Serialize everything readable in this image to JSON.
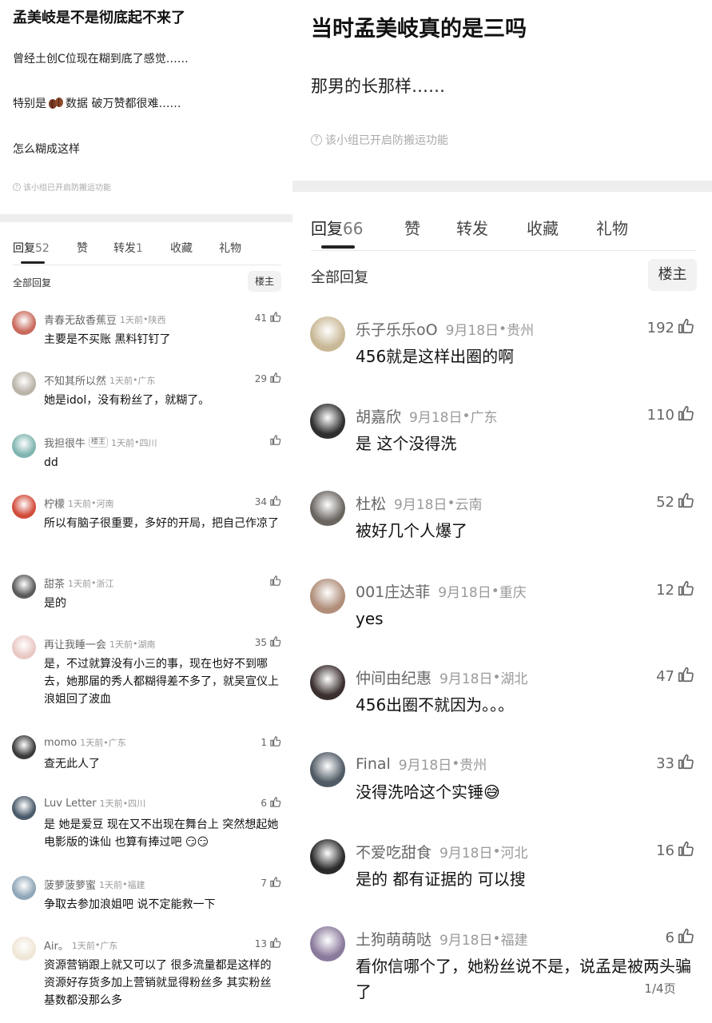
{
  "left": {
    "post_title": "孟美岐是不是彻底起不来了",
    "body_lines": [
      "曾经土创C位现在糊到底了感觉……",
      "特别是",
      "数据 破万赞都很难……",
      "怎么糊成这样"
    ],
    "anti_repost": "该小组已开启防搬运功能",
    "tabs": [
      {
        "label": "回复",
        "count": "52"
      },
      {
        "label": "赞",
        "count": ""
      },
      {
        "label": "转发",
        "count": "1"
      },
      {
        "label": "收藏",
        "count": ""
      },
      {
        "label": "礼物",
        "count": ""
      }
    ],
    "all_replies": "全部回复",
    "host_button": "楼主",
    "comments": [
      {
        "name": "青春无敌香蕉豆",
        "time": "1天前",
        "loc": "陕西",
        "likes": "41",
        "text": "主要是不买账 黑料钉钉了",
        "avatar": "#c96a5c"
      },
      {
        "name": "不知其所以然",
        "time": "1天前",
        "loc": "广东",
        "likes": "29",
        "text": "她是idol，没有粉丝了，就糊了。",
        "avatar": "#b9b3a8"
      },
      {
        "name": "我担很牛",
        "badge": "楼主",
        "time": "1天前",
        "loc": "四川",
        "likes": "",
        "text": "dd",
        "avatar": "#7fb5b0"
      },
      {
        "name": "柠檬",
        "time": "1天前",
        "loc": "河南",
        "likes": "34",
        "text": "所以有脑子很重要，多好的开局，把自己作凉了",
        "avatar": "#d24b3b"
      },
      {
        "name": "甜茶",
        "time": "1天前",
        "loc": "浙江",
        "likes": "",
        "text": "是的",
        "avatar": "#5a5a5a"
      },
      {
        "name": "再让我睡一会",
        "time": "1天前",
        "loc": "湖南",
        "likes": "35",
        "text": "是，不过就算没有小三的事，现在也好不到哪去，她那届的秀人都糊得差不多了，就吴宣仪上浪姐回了波血",
        "avatar": "#e9c8c4"
      },
      {
        "name": "momo",
        "time": "1天前",
        "loc": "广东",
        "likes": "1",
        "text": "查无此人了",
        "avatar": "#3a3a3a"
      },
      {
        "name": "Luv Letter",
        "time": "1天前",
        "loc": "四川",
        "likes": "6",
        "text": "是 她是爱豆 现在又不出现在舞台上 突然想起她电影版的诛仙 也算有捧过吧 😏😏",
        "avatar": "#4a5a6a"
      },
      {
        "name": "菠萝菠萝蜜",
        "time": "1天前",
        "loc": "福建",
        "likes": "7",
        "text": "争取去参加浪姐吧 说不定能救一下",
        "avatar": "#8fa6b6"
      },
      {
        "name": "Air。",
        "time": "1天前",
        "loc": "广东",
        "likes": "13",
        "text": "资源营销跟上就又可以了 很多流量都是这样的 资源好存货多加上营销就显得粉丝多 其实粉丝基数都没那么多",
        "avatar": "#efe6d6"
      }
    ]
  },
  "right": {
    "post_title": "当时孟美岐真的是三吗",
    "body_lines": [
      "那男的长那样……"
    ],
    "anti_repost": "该小组已开启防搬运功能",
    "tabs": [
      {
        "label": "回复",
        "count": "66"
      },
      {
        "label": "赞",
        "count": ""
      },
      {
        "label": "转发",
        "count": ""
      },
      {
        "label": "收藏",
        "count": ""
      },
      {
        "label": "礼物",
        "count": ""
      }
    ],
    "all_replies": "全部回复",
    "host_button": "楼主",
    "comments": [
      {
        "name": "乐子乐乐oO",
        "time": "9月18日",
        "loc": "贵州",
        "likes": "192",
        "text": "456就是这样出圈的啊",
        "avatar": "#c9b896"
      },
      {
        "name": "胡嘉欣",
        "time": "9月18日",
        "loc": "广东",
        "likes": "110",
        "text": "是 这个没得洗",
        "avatar": "#2f2f2f"
      },
      {
        "name": "杜松",
        "time": "9月18日",
        "loc": "云南",
        "likes": "52",
        "text": "被好几个人爆了",
        "avatar": "#6b6560"
      },
      {
        "name": "001庄达菲",
        "time": "9月18日",
        "loc": "重庆",
        "likes": "12",
        "text": "yes",
        "avatar": "#b08e7a"
      },
      {
        "name": "仲间由纪惠",
        "time": "9月18日",
        "loc": "湖北",
        "likes": "47",
        "text": "456出圈不就因为。。。",
        "avatar": "#3b2f2f"
      },
      {
        "name": "Final",
        "time": "9月18日",
        "loc": "贵州",
        "likes": "33",
        "text": "没得洗哈这个实锤😅",
        "avatar": "#4f5a64"
      },
      {
        "name": "不爱吃甜食",
        "time": "9月18日",
        "loc": "河北",
        "likes": "16",
        "text": "是的 都有证据的 可以搜",
        "avatar": "#2a2a2a"
      },
      {
        "name": "土狗萌萌哒",
        "time": "9月18日",
        "loc": "福建",
        "likes": "6",
        "text": "看你信哪个了，她粉丝说不是，说孟是被两头骗了",
        "avatar": "#8a7a9c"
      }
    ],
    "pager": "1/4页"
  }
}
